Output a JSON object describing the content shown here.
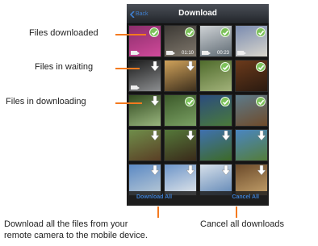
{
  "phone": {
    "nav": {
      "back_label": "Back",
      "title": "Download"
    },
    "toolbar": {
      "download_all_label": "Download All",
      "cancel_all_label": "Cancel All"
    },
    "thumbnails": [
      {
        "state": "downloaded",
        "video": true,
        "duration": "",
        "colors": [
          "#8b2d6b",
          "#d04a9a"
        ]
      },
      {
        "state": "downloaded",
        "video": true,
        "duration": "01:10",
        "colors": [
          "#3d3a35",
          "#7f776c"
        ]
      },
      {
        "state": "downloaded",
        "video": true,
        "duration": "00:23",
        "colors": [
          "#cfd3d6",
          "#5f6a73"
        ]
      },
      {
        "state": "downloaded",
        "video": true,
        "duration": "",
        "colors": [
          "#7a8bb0",
          "#d9d6cc"
        ]
      },
      {
        "state": "waiting",
        "video": true,
        "duration": "",
        "colors": [
          "#1c1c1c",
          "#8d8f91"
        ]
      },
      {
        "state": "waiting",
        "video": false,
        "duration": "",
        "colors": [
          "#d0a25a",
          "#3d2f1d"
        ]
      },
      {
        "state": "downloaded",
        "video": false,
        "duration": "",
        "colors": [
          "#4f6b2c",
          "#a2b27a"
        ]
      },
      {
        "state": "downloaded",
        "video": false,
        "duration": "",
        "colors": [
          "#6b3a1b",
          "#2a1a10"
        ]
      },
      {
        "state": "downloading",
        "video": false,
        "duration": "",
        "colors": [
          "#314a1f",
          "#99b57e"
        ]
      },
      {
        "state": "downloaded",
        "video": false,
        "duration": "",
        "colors": [
          "#3c5a2a",
          "#7aa063"
        ]
      },
      {
        "state": "downloaded",
        "video": false,
        "duration": "",
        "colors": [
          "#2b4c7e",
          "#4a7a3a"
        ]
      },
      {
        "state": "downloaded",
        "video": false,
        "duration": "",
        "colors": [
          "#5c7a8a",
          "#6f4b2a"
        ]
      },
      {
        "state": "waiting",
        "video": false,
        "duration": "",
        "colors": [
          "#6f8d4a",
          "#5a3f25"
        ]
      },
      {
        "state": "waiting",
        "video": false,
        "duration": "",
        "colors": [
          "#55783a",
          "#3a2a1a"
        ]
      },
      {
        "state": "waiting",
        "video": false,
        "duration": "",
        "colors": [
          "#3f71b0",
          "#3d6a27"
        ]
      },
      {
        "state": "waiting",
        "video": false,
        "duration": "",
        "colors": [
          "#4a86c2",
          "#547d3a"
        ]
      },
      {
        "state": "waiting",
        "video": false,
        "duration": "",
        "colors": [
          "#5b89c4",
          "#b9c9d6"
        ]
      },
      {
        "state": "waiting",
        "video": false,
        "duration": "",
        "colors": [
          "#6d95c9",
          "#e3e7ea"
        ]
      },
      {
        "state": "waiting",
        "video": false,
        "duration": "",
        "colors": [
          "#d7e0ea",
          "#5f86b5"
        ]
      },
      {
        "state": "waiting",
        "video": false,
        "duration": "",
        "colors": [
          "#6b4a2a",
          "#c4a16b"
        ]
      }
    ]
  },
  "annotations": {
    "files_downloaded": "Files downloaded",
    "files_waiting": "Files in waiting",
    "files_downloading": "Files in downloading",
    "download_all_desc_line1": "Download all the files from your",
    "download_all_desc_line2": "remote camera to the mobile device.",
    "cancel_all_desc": "Cancel all downloads"
  },
  "colors": {
    "accent": "#3f7fd0",
    "callout": "#f47a1f",
    "check": "#7cc15a"
  }
}
